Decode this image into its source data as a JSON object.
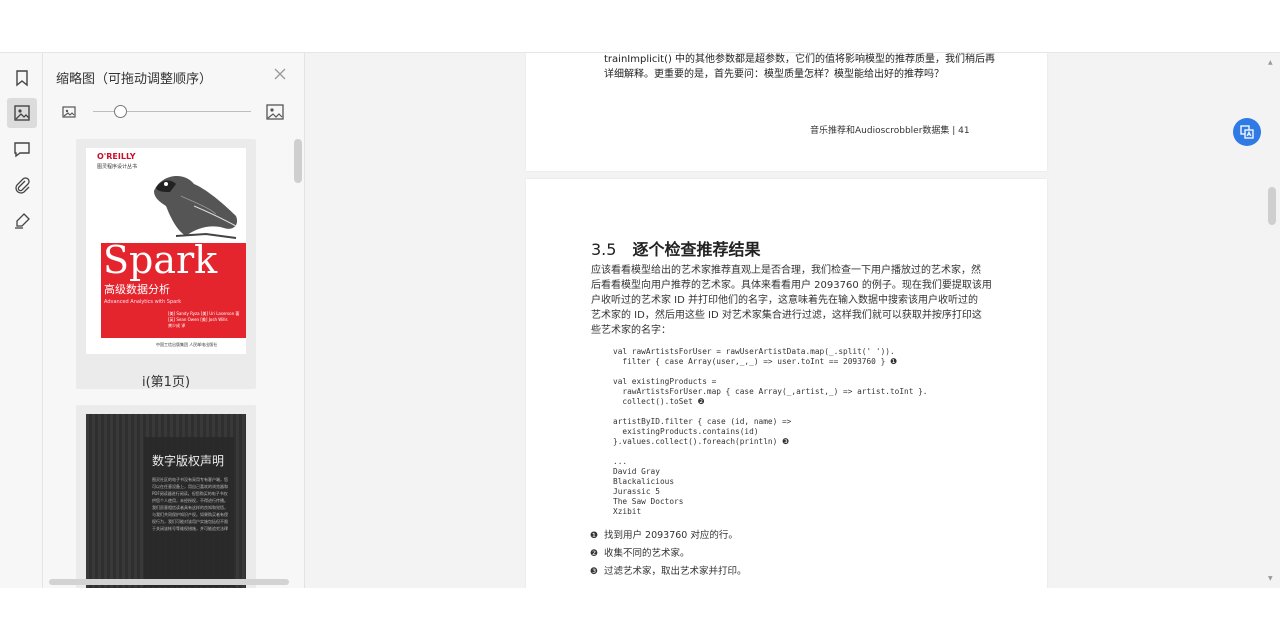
{
  "sidebar_tools": [
    {
      "name": "bookmark-icon"
    },
    {
      "name": "thumbnail-icon",
      "active": true
    },
    {
      "name": "comment-icon"
    },
    {
      "name": "attachment-icon"
    },
    {
      "name": "signature-icon"
    }
  ],
  "thumbnail_panel": {
    "title": "缩略图（可拖动调整顺序）",
    "close_icon": "close-icon",
    "zoom_level": 0.18,
    "thumbnails": [
      {
        "label": "i(第1页)",
        "cover": {
          "publisher": "O'REILLY",
          "series": "图灵程序设计丛书",
          "title": "Spark",
          "subtitle_cn": "高级数据分析",
          "subtitle_en": "Advanced Analytics with Spark",
          "authors": [
            "[美] Sandy Ryza  [美] Uri Laserson  著",
            "[英] Sean Owen  [美] Josh Wills",
            "龚少成 译"
          ],
          "press": "中国工信出版集团   人民邮电出版社"
        }
      },
      {
        "label": "",
        "cover": {
          "title": "数字版权声明",
          "text": "图灵社区的电子书没有采用专有客户端，您可以在任意设备上，用自己喜欢的浏览器和PDF阅读器进行阅读。但您购买的电子书仅供您个人使用，未经授权，不得进行传播。我们愿意相信读者具有这样的良知和觉悟，与我们共同保护知识产权。如果购买者有侵权行为，我们可能对该用户实施包括但不限于关闭该帐号等维权措施，并可能追究法律"
        }
      }
    ]
  },
  "document": {
    "page1": {
      "lines": [
        "trainImplicit() 中的其他参数都是超参数，它们的值将影响模型的推荐质量，我们稍后再",
        "详细解释。更重要的是，首先要问：模型质量怎样？模型能给出好的推荐吗？"
      ],
      "footer": "音乐推荐和Audioscrobbler数据集   |   41"
    },
    "page2": {
      "section_number": "3.5",
      "section_title": "逐个检查推荐结果",
      "paragraph": [
        "应该看看模型给出的艺术家推荐直观上是否合理，我们检查一下用户播放过的艺术家，然",
        "后看看模型向用户推荐的艺术家。具体来看看用户 2093760 的例子。现在我们要提取该用",
        "户收听过的艺术家 ID 并打印他们的名字，这意味着先在输入数据中搜索该用户收听过的",
        "艺术家的 ID，然后用这些 ID 对艺术家集合进行过滤，这样我们就可以获取并按序打印这",
        "些艺术家的名字："
      ],
      "code": [
        "val rawArtistsForUser = rawUserArtistData.map(_.split(' ')).",
        "  filter { case Array(user,_,_) => user.toInt == 2093760 } ❶",
        "",
        "val existingProducts =",
        "  rawArtistsForUser.map { case Array(_,artist,_) => artist.toInt }.",
        "  collect().toSet ❷",
        "",
        "artistByID.filter { case (id, name) =>",
        "  existingProducts.contains(id)",
        "}.values.collect().foreach(println) ❸",
        "",
        "...",
        "David Gray",
        "Blackalicious",
        "Jurassic 5",
        "The Saw Doctors",
        "Xzibit"
      ],
      "callouts": [
        {
          "mark": "❶",
          "text": "找到用户 2093760 对应的行。"
        },
        {
          "mark": "❷",
          "text": "收集不同的艺术家。"
        },
        {
          "mark": "❸",
          "text": "过滤艺术家，取出艺术家并打印。"
        }
      ]
    }
  },
  "floating_button_icon": "translate-icon",
  "colors": {
    "accent": "#2f7ae5",
    "cover_red": "#e4252e"
  }
}
